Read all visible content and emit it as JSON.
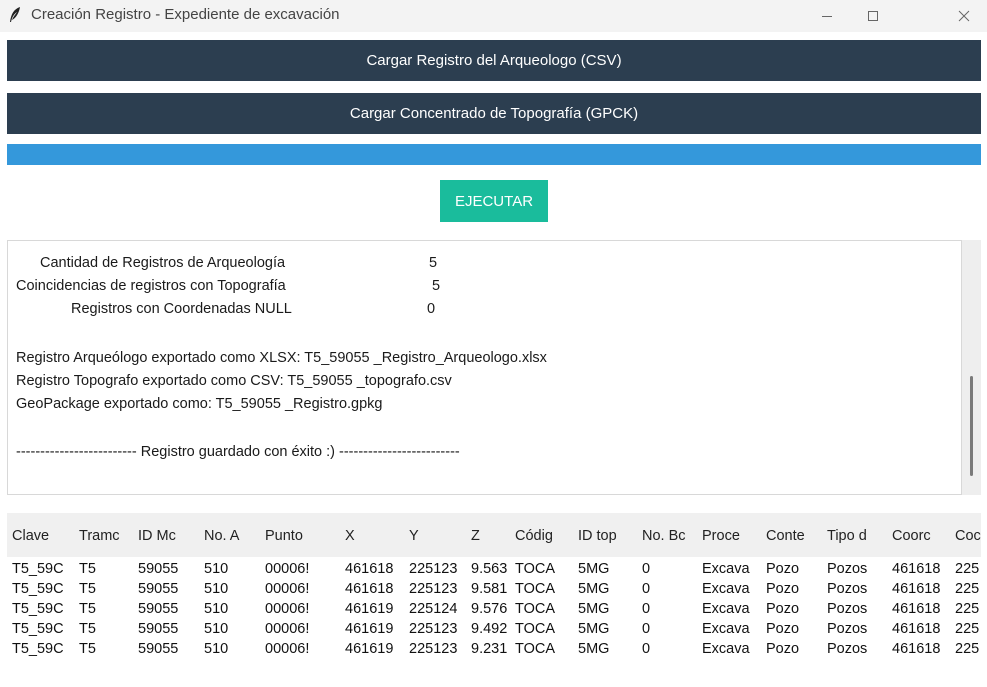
{
  "window": {
    "title": "Creación Registro - Expediente de excavación",
    "icon": "feather-icon",
    "controls": [
      "minimize-icon",
      "maximize-icon",
      "close-icon"
    ]
  },
  "buttons": {
    "load_csv": "Cargar Registro del Arqueologo (CSV)",
    "load_gpck": "Cargar Concentrado de Topografía (GPCK)",
    "execute": "EJECUTAR"
  },
  "progress": {
    "value": 1.0
  },
  "log": {
    "stats": [
      {
        "label": "Cantidad de Registros de Arqueología",
        "value": "5"
      },
      {
        "label": "Coincidencias de registros con Topografía",
        "value": "5"
      },
      {
        "label": "Registros con Coordenadas NULL",
        "value": "0"
      }
    ],
    "exports": [
      "Registro Arqueólogo exportado como XLSX:  T5_59055 _Registro_Arqueologo.xlsx",
      "Registro Topografo exportado como CSV:  T5_59055 _topografo.csv",
      "GeoPackage exportado como:  T5_59055 _Registro.gpkg"
    ],
    "success": "------------------------- Registro guardado con éxito :) -------------------------"
  },
  "table": {
    "columns": [
      "Clave",
      "Tramc",
      "ID Mc",
      "No. A",
      "Punto",
      "X",
      "Y",
      "Z",
      "Códig",
      "ID top",
      "No. Bc",
      "Proce",
      "Conte",
      "Tipo d",
      "Coorc",
      "Coc"
    ],
    "rows": [
      [
        "T5_59C",
        "T5",
        "59055",
        "510",
        "00006!",
        "461618",
        "225123",
        "9.563",
        "TOCA",
        "5MG",
        "0",
        "Excava",
        "Pozo",
        "Pozos",
        "461618",
        "225"
      ],
      [
        "T5_59C",
        "T5",
        "59055",
        "510",
        "00006!",
        "461618",
        "225123",
        "9.581",
        "TOCA",
        "5MG",
        "0",
        "Excava",
        "Pozo",
        "Pozos",
        "461618",
        "225"
      ],
      [
        "T5_59C",
        "T5",
        "59055",
        "510",
        "00006!",
        "461619",
        "225124",
        "9.576",
        "TOCA",
        "5MG",
        "0",
        "Excava",
        "Pozo",
        "Pozos",
        "461618",
        "225"
      ],
      [
        "T5_59C",
        "T5",
        "59055",
        "510",
        "00006!",
        "461619",
        "225123",
        "9.492",
        "TOCA",
        "5MG",
        "0",
        "Excava",
        "Pozo",
        "Pozos",
        "461618",
        "225"
      ],
      [
        "T5_59C",
        "T5",
        "59055",
        "510",
        "00006!",
        "461619",
        "225123",
        "9.231",
        "TOCA",
        "5MG",
        "0",
        "Excava",
        "Pozo",
        "Pozos",
        "461618",
        "225"
      ]
    ]
  }
}
